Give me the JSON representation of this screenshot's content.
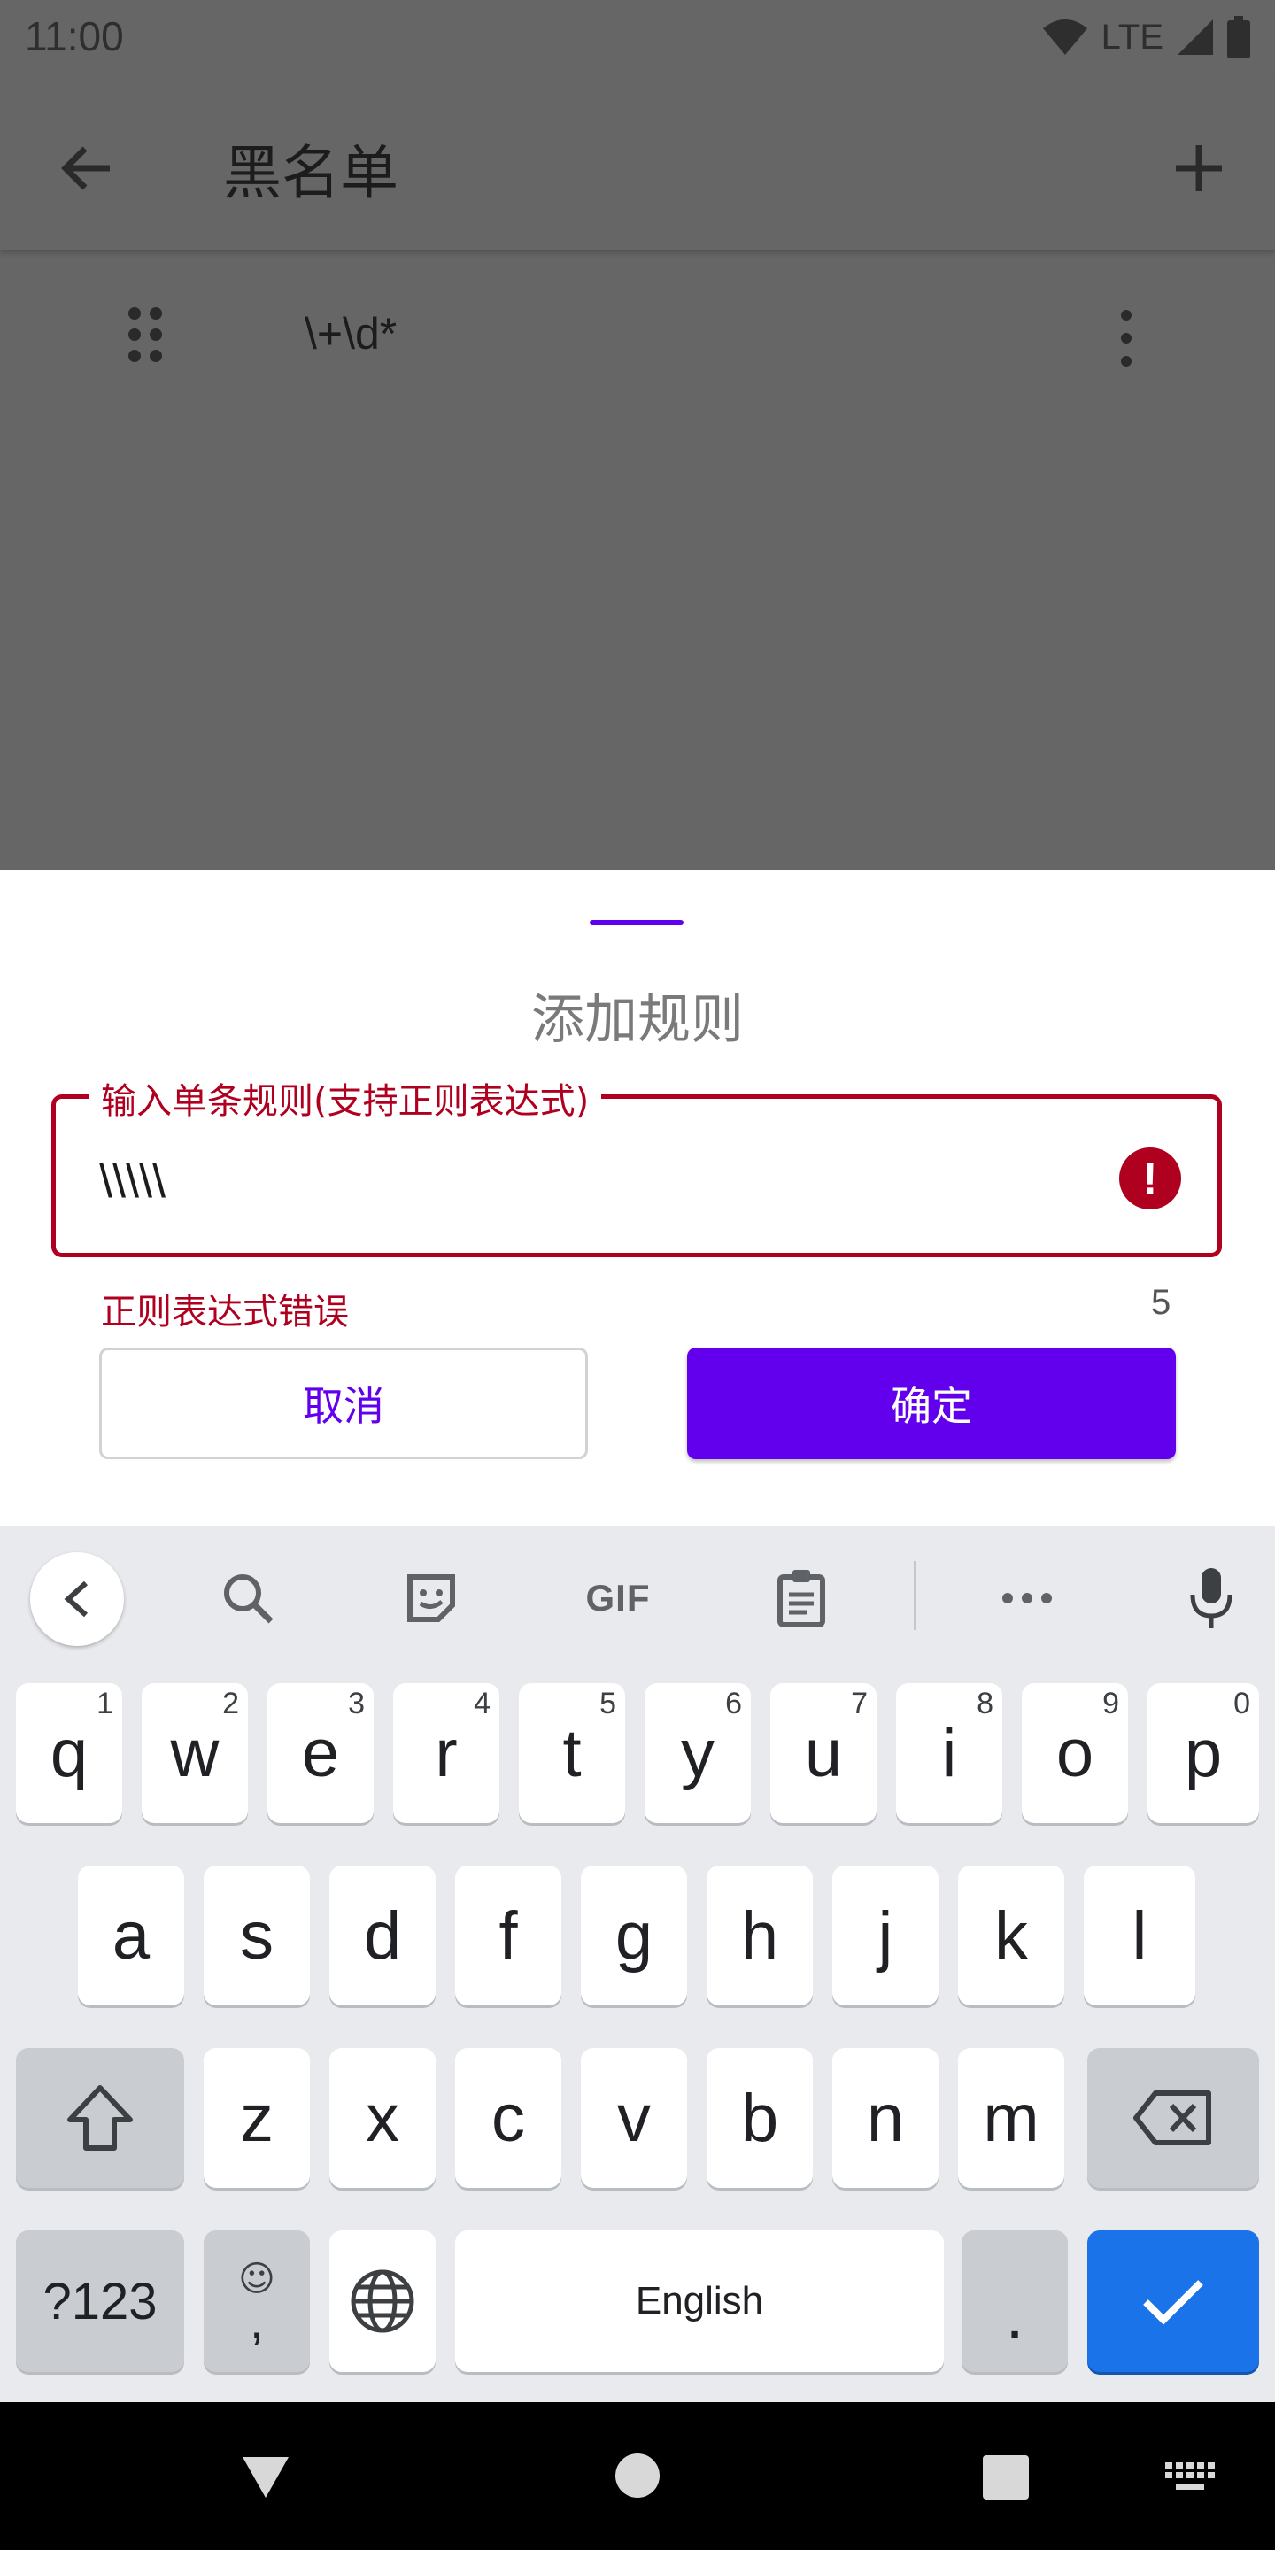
{
  "status_bar": {
    "time": "11:00",
    "network": "LTE"
  },
  "app_bar": {
    "title": "黑名单"
  },
  "rules": [
    {
      "pattern": "\\+\\d*"
    }
  ],
  "dialog": {
    "title": "添加规则",
    "field_label": "输入单条规则(支持正则表达式)",
    "field_value": "\\\\\\\\\\",
    "helper_text": "正则表达式错误",
    "char_count": "5",
    "cancel_label": "取消",
    "confirm_label": "确定"
  },
  "keyboard": {
    "row1": [
      {
        "key": "q",
        "hint": "1"
      },
      {
        "key": "w",
        "hint": "2"
      },
      {
        "key": "e",
        "hint": "3"
      },
      {
        "key": "r",
        "hint": "4"
      },
      {
        "key": "t",
        "hint": "5"
      },
      {
        "key": "y",
        "hint": "6"
      },
      {
        "key": "u",
        "hint": "7"
      },
      {
        "key": "i",
        "hint": "8"
      },
      {
        "key": "o",
        "hint": "9"
      },
      {
        "key": "p",
        "hint": "0"
      }
    ],
    "row2": [
      "a",
      "s",
      "d",
      "f",
      "g",
      "h",
      "j",
      "k",
      "l"
    ],
    "row3": [
      "z",
      "x",
      "c",
      "v",
      "b",
      "n",
      "m"
    ],
    "symbols_label": "?123",
    "comma_label": ",",
    "space_label": "English",
    "period_label": "."
  },
  "colors": {
    "accent": "#6200ee",
    "error": "#b00020",
    "enter": "#1a73e8",
    "scrim": "#666666"
  }
}
